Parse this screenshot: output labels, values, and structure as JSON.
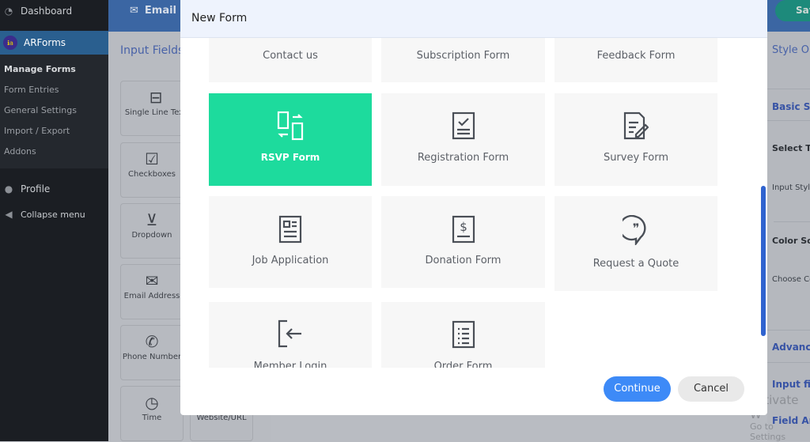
{
  "sidebar": {
    "dashboard": "Dashboard",
    "arforms": "ARForms",
    "items": [
      "Manage Forms",
      "Form Entries",
      "General Settings",
      "Import / Export",
      "Addons"
    ],
    "profile": "Profile",
    "collapse": "Collapse menu"
  },
  "topbar": {
    "email": "Email",
    "save": "Save"
  },
  "left_panel": {
    "title": "Input Fields",
    "fields": [
      "Single Line Text",
      "Checkboxes",
      "Dropdown",
      "Email Address",
      "Phone Number",
      "Time",
      "Website/URL"
    ]
  },
  "right_panel": {
    "title": "Style O",
    "basic": "Basic Sty",
    "select_theme": "Select Th",
    "input_style": "Input Style",
    "color_scheme": "Color Sch",
    "choose_color": "Choose Co",
    "advanced": "Advance",
    "input_field": "Input fie",
    "field_anim": "Field An"
  },
  "watermark": {
    "line1": "Activate W",
    "line2": "Go to Settings"
  },
  "modal": {
    "title": "New Form",
    "tiles": [
      "Contact us",
      "Subscription Form",
      "Feedback Form",
      "RSVP Form",
      "Registration Form",
      "Survey Form",
      "Job Application",
      "Donation Form",
      "Request a Quote",
      "Member Login",
      "Order Form"
    ],
    "selected": "RSVP Form",
    "continue": "Continue",
    "cancel": "Cancel"
  },
  "colors": {
    "accent": "#1ddb9d",
    "primary_button": "#3d8af7",
    "sidebar_active": "#2a5f8f"
  }
}
